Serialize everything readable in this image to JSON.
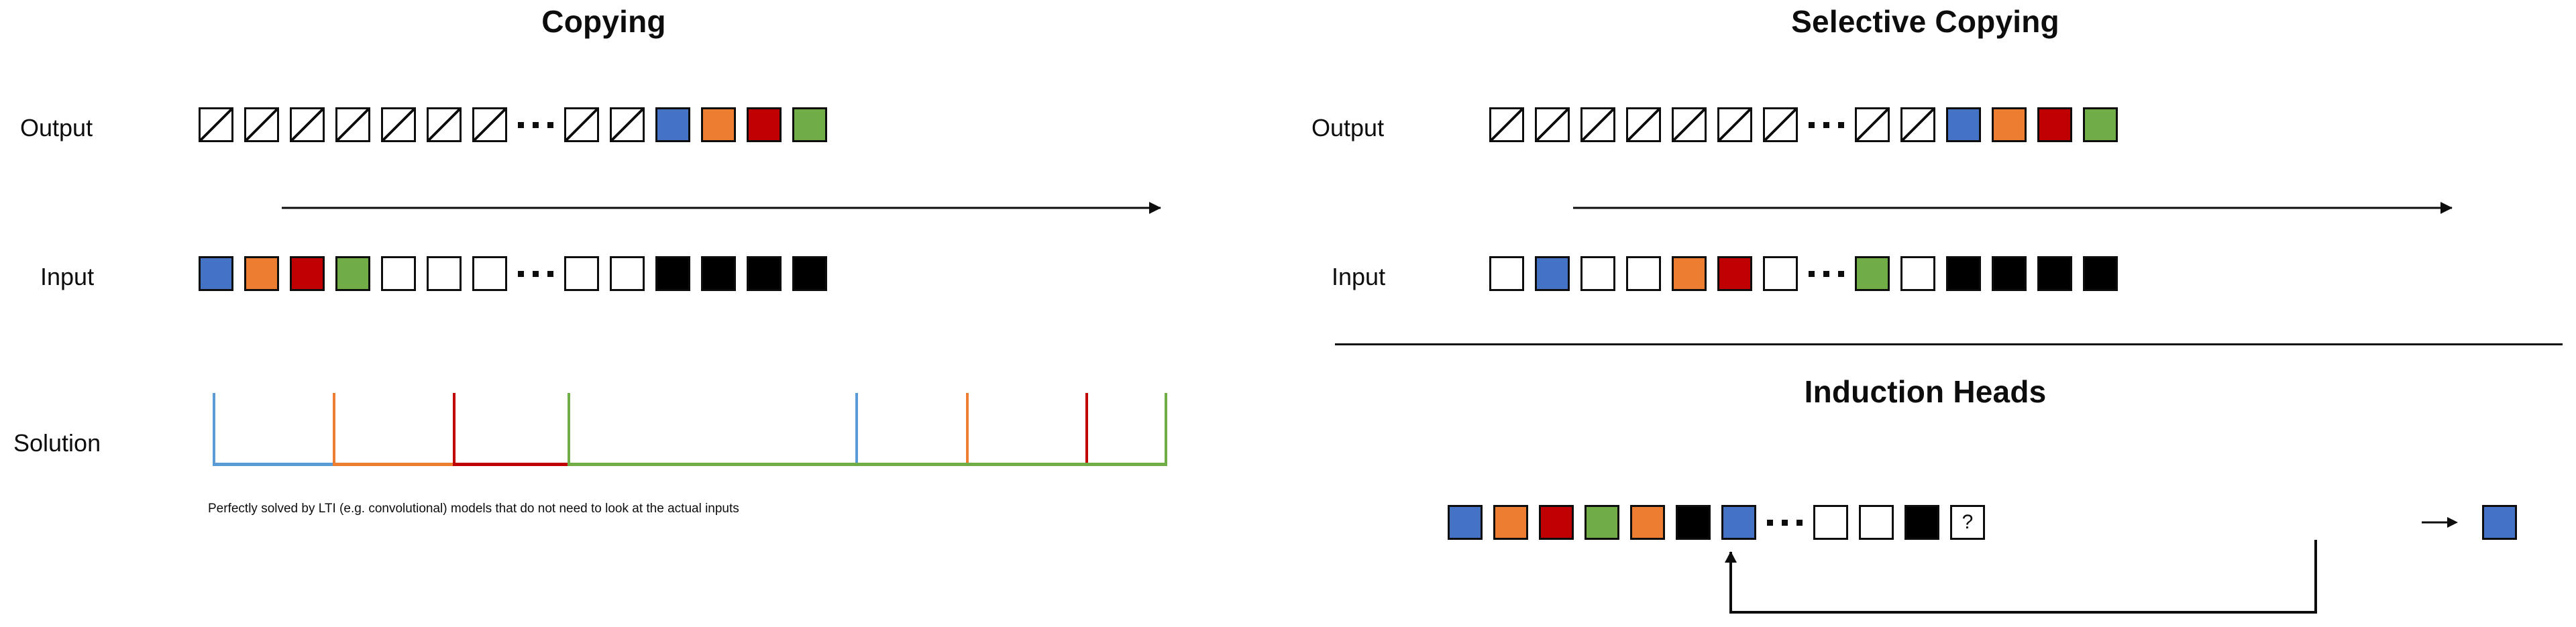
{
  "colors": {
    "blue": "#4472C4",
    "orange": "#ED7D31",
    "red": "#C00000",
    "green": "#70AD47",
    "black": "#000000",
    "white": "#FFFFFF",
    "outline": "#0D0D0D",
    "background": "#FFFFFF"
  },
  "panels": {
    "copying": {
      "title": "Copying",
      "output_label": "Output",
      "input_label": "Input",
      "solution_label": "Solution",
      "caption": "Perfectly solved by LTI (e.g. convolutional) models that do not need to look at the actual inputs",
      "output_cells": [
        "slash",
        "slash",
        "slash",
        "slash",
        "slash",
        "slash",
        "slash",
        "ellipsis",
        "slash",
        "slash",
        "blue",
        "orange",
        "red",
        "green"
      ],
      "input_cells": [
        "blue",
        "orange",
        "red",
        "green",
        "white",
        "white",
        "white",
        "ellipsis",
        "white",
        "white",
        "black",
        "black",
        "black",
        "black"
      ]
    },
    "selective_copying": {
      "title": "Selective Copying",
      "output_label": "Output",
      "input_label": "Input",
      "output_cells": [
        "slash",
        "slash",
        "slash",
        "slash",
        "slash",
        "slash",
        "slash",
        "ellipsis",
        "slash",
        "slash",
        "blue",
        "orange",
        "red",
        "green"
      ],
      "input_cells": [
        "white",
        "blue",
        "white",
        "white",
        "orange",
        "red",
        "white",
        "ellipsis",
        "green",
        "white",
        "black",
        "black",
        "black",
        "black"
      ]
    },
    "induction_heads": {
      "title": "Induction Heads",
      "sequence_cells": [
        "blue",
        "orange",
        "red",
        "green",
        "orange",
        "black",
        "blue",
        "ellipsis",
        "white",
        "white",
        "black",
        "question"
      ],
      "question_mark": "?",
      "prediction_cell": "blue"
    }
  },
  "chart_data": {
    "type": "line",
    "title": "Solution",
    "xlabel": "",
    "ylabel": "",
    "description": "Impulse train: colored spikes at the positions of the four colored input tokens and again at the corresponding output positions.",
    "grid": false,
    "legend": false,
    "xlim": [
      0,
      100
    ],
    "ylim": [
      0,
      1
    ],
    "series": [
      {
        "name": "blue",
        "color": "#5B9BD5",
        "spikes_x": [
          0.5,
          67.5
        ],
        "spike_height": 1.0,
        "baseline_from": 0.5,
        "baseline_to": 13.0
      },
      {
        "name": "orange",
        "color": "#ED7D31",
        "spikes_x": [
          13.0,
          79.0
        ],
        "spike_height": 1.0,
        "baseline_from": 13.0,
        "baseline_to": 25.5
      },
      {
        "name": "red",
        "color": "#C00000",
        "spikes_x": [
          25.5,
          91.5
        ],
        "spike_height": 1.0,
        "baseline_from": 25.5,
        "baseline_to": 37.5
      },
      {
        "name": "green",
        "color": "#70AD47",
        "spikes_x": [
          37.5,
          100.0
        ],
        "spike_height": 1.0,
        "baseline_from": 37.5,
        "baseline_to": 100.0
      }
    ]
  }
}
